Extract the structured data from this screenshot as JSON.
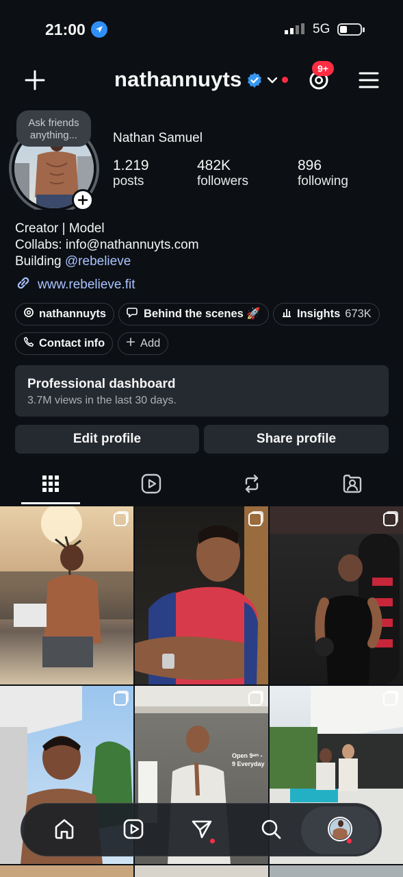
{
  "status_bar": {
    "time": "21:00",
    "network": "5G"
  },
  "header": {
    "username": "nathannuyts",
    "threads_badge": "9+"
  },
  "profile": {
    "note": "Ask friends anything...",
    "name": "Nathan Samuel",
    "stats": [
      {
        "value": "1.219",
        "label": "posts"
      },
      {
        "value": "482K",
        "label": "followers"
      },
      {
        "value": "896",
        "label": "following"
      }
    ],
    "bio_lines": [
      "Creator | Model",
      "Collabs: info@nathannuyts.com"
    ],
    "bio_building": "Building",
    "bio_mention": "@rebelieve",
    "website": "www.rebelieve.fit"
  },
  "chips": {
    "threads": "nathannuyts",
    "behind": "Behind the scenes 🚀",
    "insights": "Insights",
    "insights_value": "673K",
    "contact": "Contact info",
    "add": "Add"
  },
  "dashboard": {
    "title": "Professional dashboard",
    "subtitle": "3.7M views in the last 30 days."
  },
  "actions": {
    "edit": "Edit profile",
    "share": "Share profile"
  },
  "tabs": [
    "grid-icon",
    "reels-icon",
    "reposts-icon",
    "tagged-icon"
  ],
  "grid_overlay_text": "Open 9ᵃᵐ - 9 Everyday",
  "nav": [
    "home-icon",
    "reels-icon",
    "direct-icon",
    "search-icon",
    "profile-avatar"
  ]
}
